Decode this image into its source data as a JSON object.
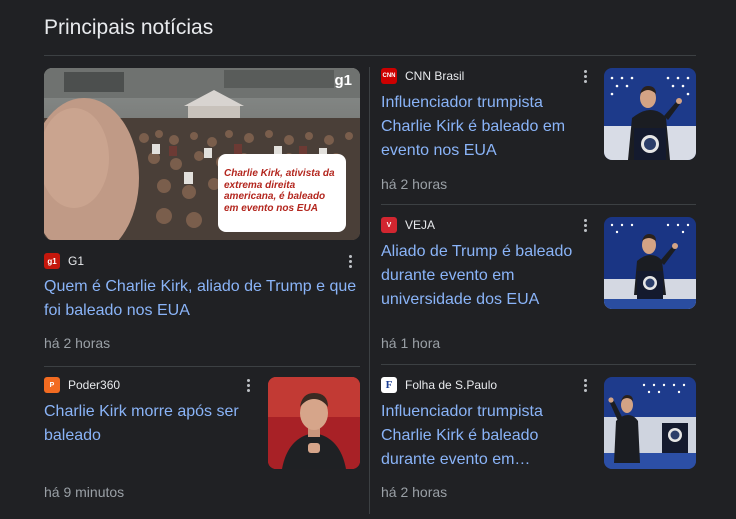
{
  "section_title": "Principais notícias",
  "hero": {
    "source": "G1",
    "source_icon_text": "g1",
    "watermark": "g1",
    "overlay": "Charlie Kirk, ativista da extrema direita americana, é baleado em evento nos EUA",
    "headline": "Quem é Charlie Kirk, aliado de Trump e que foi baleado nos EUA",
    "time": "há 2 horas"
  },
  "left_bottom": {
    "source": "Poder360",
    "source_icon_text": "P",
    "headline": "Charlie Kirk morre após ser baleado",
    "time": "há 9 minutos"
  },
  "right_items": [
    {
      "source": "CNN Brasil",
      "source_icon_text": "CNN",
      "headline": "Influenciador trumpista Charlie Kirk é baleado em evento nos EUA",
      "time": "há 2 horas"
    },
    {
      "source": "VEJA",
      "source_icon_text": "V",
      "headline": "Aliado de Trump é baleado durante evento em universidade dos EUA",
      "time": "há 1 hora"
    },
    {
      "source": "Folha de S.Paulo",
      "source_icon_text": "F",
      "headline": "Influenciador trumpista Charlie Kirk é baleado durante evento em…",
      "time": "há 2 horas"
    }
  ],
  "colors": {
    "background": "#202124",
    "link": "#8ab4f8",
    "text": "#e8eaed",
    "muted": "#9aa0a6",
    "divider": "#3c4043"
  }
}
